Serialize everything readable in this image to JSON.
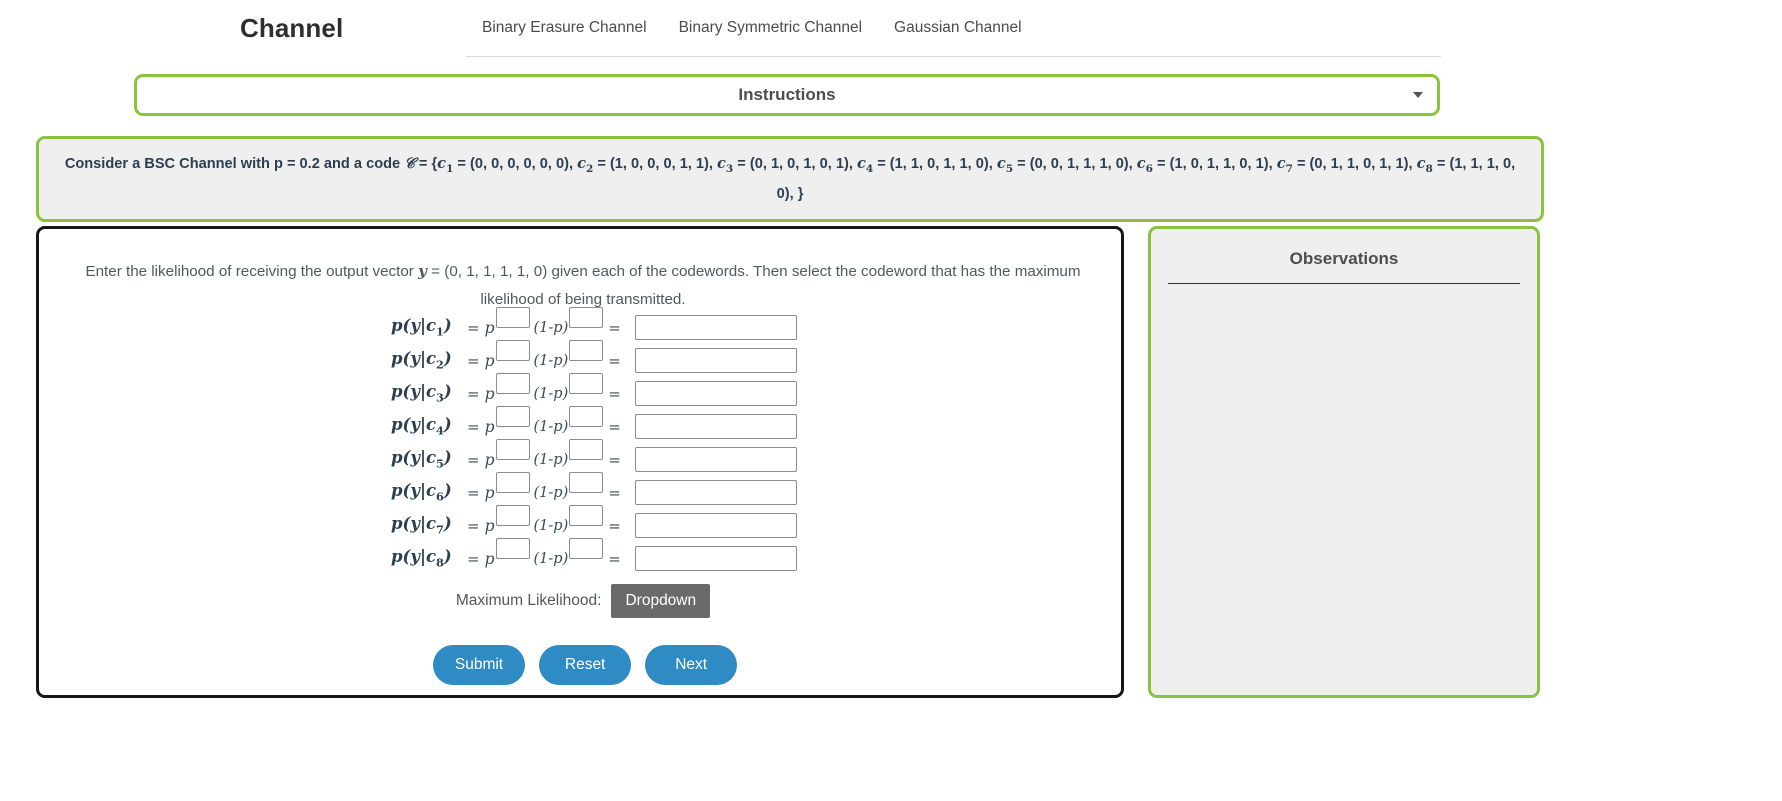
{
  "header": {
    "brand": "Channel",
    "nav_items": [
      {
        "label": "Binary Erasure Channel"
      },
      {
        "label": "Binary Symmetric Channel"
      },
      {
        "label": "Gaussian Channel"
      }
    ]
  },
  "instructions": {
    "title": "Instructions",
    "caret_icon": "chevron-down-icon"
  },
  "problem": {
    "text": "Consider a BSC Channel with p = 0.2 and a code 𝒞 = {c₁ = (0, 0, 0, 0, 0, 0), c₂ = (1, 0, 0, 0, 1, 1), c₃ = (0, 1, 0, 1, 0, 1), c₄ = (1, 1, 0, 1, 1, 0), c₅ = (0, 0, 1, 1, 1, 0), c₆ = (1, 0, 1, 1, 0, 1), c₇ = (0, 1, 1, 0, 1, 1), c₈ = (1, 1, 1, 0, 0, 0), }",
    "prefix": "Consider a BSC Channel with p = 0.2 and a code",
    "code_symbol": "𝒞",
    "equals": " = {",
    "p_value": "0.2",
    "closing": "0, 0), }",
    "codewords": [
      {
        "name": "c",
        "index": "1",
        "value": "(0, 0, 0, 0, 0, 0)"
      },
      {
        "name": "c",
        "index": "2",
        "value": "(1, 0, 0, 0, 1, 1)"
      },
      {
        "name": "c",
        "index": "3",
        "value": "(0, 1, 0, 1, 0, 1)"
      },
      {
        "name": "c",
        "index": "4",
        "value": "(1, 1, 0, 1, 1, 0)"
      },
      {
        "name": "c",
        "index": "5",
        "value": "(0, 0, 1, 1, 1, 0)"
      },
      {
        "name": "c",
        "index": "6",
        "value": "(1, 0, 1, 1, 0, 1)"
      },
      {
        "name": "c",
        "index": "7",
        "value": "(0, 1, 1, 0, 1, 1)"
      },
      {
        "name": "c",
        "index": "8",
        "value": "(1, 1, 1, 0, 0, 0)"
      }
    ]
  },
  "work": {
    "prompt_part1": "Enter the likelihood of receiving the output vector",
    "prompt_y_symbol": "y",
    "prompt_part2": "= (0, 1, 1, 1, 1, 0) given each of the codewords. Then select the codeword that has the maximum likelihood of being transmitted.",
    "output_vector": "(0, 1, 1, 1, 1, 0)",
    "rows": [
      {
        "label_sub": "1",
        "p_exp_value": "",
        "q_exp_value": "",
        "result_value": ""
      },
      {
        "label_sub": "2",
        "p_exp_value": "",
        "q_exp_value": "",
        "result_value": ""
      },
      {
        "label_sub": "3",
        "p_exp_value": "",
        "q_exp_value": "",
        "result_value": ""
      },
      {
        "label_sub": "4",
        "p_exp_value": "",
        "q_exp_value": "",
        "result_value": ""
      },
      {
        "label_sub": "5",
        "p_exp_value": "",
        "q_exp_value": "",
        "result_value": ""
      },
      {
        "label_sub": "6",
        "p_exp_value": "",
        "q_exp_value": "",
        "result_value": ""
      },
      {
        "label_sub": "7",
        "p_exp_value": "",
        "q_exp_value": "",
        "result_value": ""
      },
      {
        "label_sub": "8",
        "p_exp_value": "",
        "q_exp_value": "",
        "result_value": ""
      }
    ],
    "row_p_text": "p",
    "row_q_text": "(1-p)",
    "row_eq_text": "=",
    "max_likelihood_label": "Maximum Likelihood:",
    "dropdown_label": "Dropdown",
    "buttons": [
      {
        "label": "Submit"
      },
      {
        "label": "Reset"
      },
      {
        "label": "Next"
      }
    ]
  },
  "observations": {
    "title": "Observations",
    "body": ""
  },
  "colors": {
    "accent_green": "#8ac43f",
    "button_blue": "#2e8bc4",
    "dropdown_gray": "#6a6a6a",
    "panel_gray": "#efefef",
    "panel_border_dark": "#161616"
  }
}
